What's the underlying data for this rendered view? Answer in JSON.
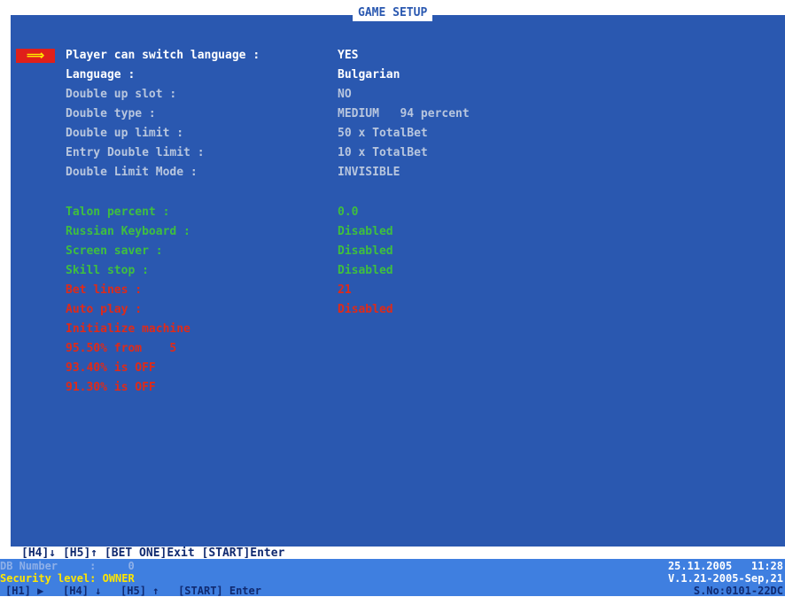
{
  "title": "GAME SETUP",
  "selector_arrow": "⟹",
  "settings": [
    {
      "label": "Player can switch language :",
      "value": "YES"
    },
    {
      "label": "Language :",
      "value": "Bulgarian"
    },
    {
      "label": "Double up slot :",
      "value": "NO"
    },
    {
      "label": "Double type :",
      "value": "MEDIUM   94 percent"
    },
    {
      "label": "Double up limit :",
      "value": "50 x TotalBet"
    },
    {
      "label": "Entry Double limit :",
      "value": "10 x TotalBet"
    },
    {
      "label": "Double Limit Mode :",
      "value": "INVISIBLE"
    },
    {
      "label": "Talon percent :",
      "value": "0.0"
    },
    {
      "label": "Russian Keyboard :",
      "value": "Disabled"
    },
    {
      "label": "Screen saver :",
      "value": "Disabled"
    },
    {
      "label": "Skill stop :",
      "value": "Disabled"
    },
    {
      "label": "Bet lines :",
      "value": "21"
    },
    {
      "label": "Auto play :",
      "value": "Disabled"
    }
  ],
  "actions": [
    "Initialize machine",
    "95.50% from    5",
    "93.40% is OFF",
    "91.30% is OFF"
  ],
  "key_help": "[H4]↓ [H5]↑ [BET ONE]Exit [START]Enter",
  "status": {
    "db_number": "DB Number     :     0",
    "security": "Security level: OWNER",
    "keys": "[H1] ▶   [H4] ↓   [H5] ↑   [START] Enter",
    "datetime": "25.11.2005   11:28",
    "version": "V.1.21-2005-Sep,21",
    "serial": "S.No:0101-22DC"
  }
}
